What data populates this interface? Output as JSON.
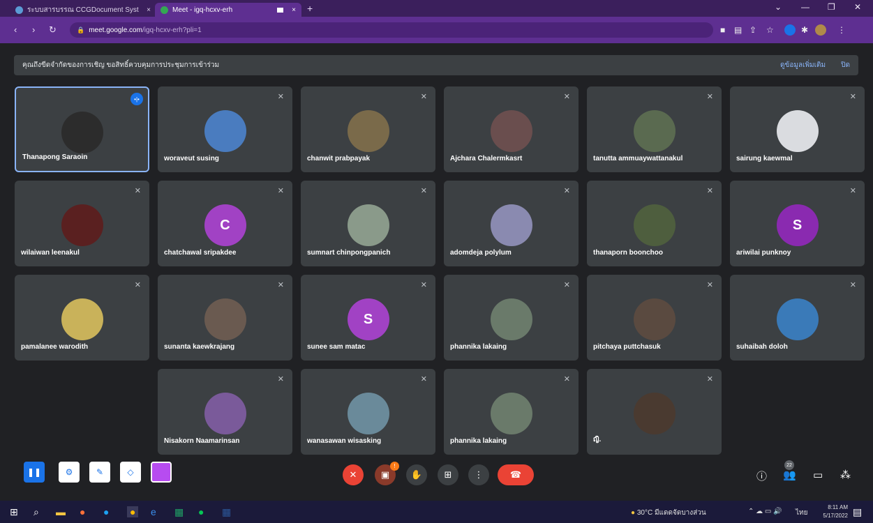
{
  "browser": {
    "tabs": [
      {
        "label": "ระบบสารบรรณ CCGDocument Syst",
        "fav": "#5b9bd5"
      },
      {
        "label": "Meet - igq-hcxv-erh",
        "fav": "#34a853"
      }
    ],
    "tab_close": "×",
    "new_tab": "+",
    "url_host": "meet.google.com",
    "url_path": "/igq-hcxv-erh?pli=1",
    "window_controls": [
      "⌄",
      "—",
      "❐",
      "✕"
    ]
  },
  "banner": {
    "text": "คุณถึงขีดจำกัดของการเชิญ ขอสิทธิ์ควบคุมการประชุมการเข้าร่วม",
    "link_1": "ดูข้อมูลเพิ่มเติม",
    "link_2": "ปิด"
  },
  "participants": [
    {
      "name": "Thanapong Saraoin",
      "initial": "",
      "color": "#2c2c2c",
      "speaking": true
    },
    {
      "name": "woraveut susing",
      "initial": "",
      "color": "#4a7cbf"
    },
    {
      "name": "chanwit prabpayak",
      "initial": "",
      "color": "#7a6a4a"
    },
    {
      "name": "Ajchara Chalermkasrt",
      "initial": "",
      "color": "#6a4e4e"
    },
    {
      "name": "tanutta ammuaywattanakul",
      "initial": "",
      "color": "#5a6a50"
    },
    {
      "name": "sairung kaewmal",
      "initial": "",
      "color": "#dadce0"
    },
    {
      "name": "wilaiwan leenakul",
      "initial": "",
      "color": "#5a2020"
    },
    {
      "name": "chatchawal sripakdee",
      "initial": "C",
      "color": "#a142c4"
    },
    {
      "name": "sumnart chinpongpanich",
      "initial": "",
      "color": "#8a9a8a"
    },
    {
      "name": "adomdeja polylum",
      "initial": "",
      "color": "#8a8ab0"
    },
    {
      "name": "thanaporn boonchoo",
      "initial": "",
      "color": "#4e5e3e"
    },
    {
      "name": "ariwilai punknoy",
      "initial": "S",
      "color": "#8a2ab0"
    },
    {
      "name": "pamalanee warodith",
      "initial": "",
      "color": "#c9b25a"
    },
    {
      "name": "sunanta kaewkrajang",
      "initial": "",
      "color": "#6a5a50"
    },
    {
      "name": "sunee sam matac",
      "initial": "S",
      "color": "#a142c4"
    },
    {
      "name": "phannika lakaing",
      "initial": "",
      "color": "#6a7a6a"
    },
    {
      "name": "pitchaya puttchasuk",
      "initial": "",
      "color": "#5a4a40"
    },
    {
      "name": "suhaibah doloh",
      "initial": "",
      "color": "#3a7ab8"
    },
    {
      "name": "Nisakorn Naamarinsan",
      "initial": "",
      "color": "#7a5a9a"
    },
    {
      "name": "wanasawan wisasking",
      "initial": "",
      "color": "#6a8a9a"
    },
    {
      "name": "phannika lakaing",
      "initial": "",
      "color": "#6a7a6a"
    },
    {
      "name": "ญิ.",
      "initial": "",
      "color": "#4a3a30"
    }
  ],
  "mic_icon": "✕",
  "controls": {
    "meeting_code": "igq-hcxv-erh",
    "reactions_badge": "!",
    "people_count": "22"
  },
  "annotation_tools": [
    "❚❚",
    "⚙",
    "✎",
    "◇",
    ""
  ],
  "taskbar": {
    "weather": "30°C มีแดดจัดบางส่วน",
    "lang": "ไทย",
    "time": "8:11 AM",
    "date": "5/17/2022"
  },
  "colors": {
    "accent": "#1a73e8",
    "danger": "#ea4335",
    "browser_frame": "#5e2f91"
  }
}
